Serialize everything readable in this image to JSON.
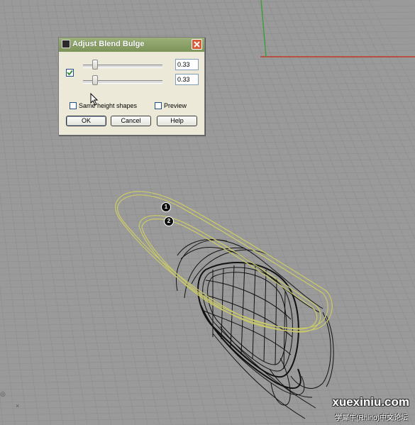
{
  "dialog": {
    "title": "Adjust Blend Bulge",
    "slider1_value": "0.33",
    "slider2_value": "0.33",
    "slider1_fraction": 0.12,
    "slider2_fraction": 0.12,
    "same_height_label": "Same height shapes",
    "preview_label": "Preview",
    "same_height_checked": false,
    "preview_checked": false,
    "lock_checked": true,
    "ok_label": "OK",
    "cancel_label": "Cancel",
    "help_label": "Help"
  },
  "markers": [
    "1",
    "2"
  ],
  "viewport": {
    "axis_x_label": "×",
    "axis_y_label": "◎",
    "colors": {
      "background": "#9a9a9a",
      "grid": "#8d8d8d",
      "x_axis": "#c0392b",
      "y_axis": "#3f9f3f",
      "curve": "#c8c86a",
      "mesh": "#111111"
    }
  },
  "watermark": {
    "main": "xuexiniu.com",
    "sub": "学犀牛(Rhino)中文论坛"
  }
}
